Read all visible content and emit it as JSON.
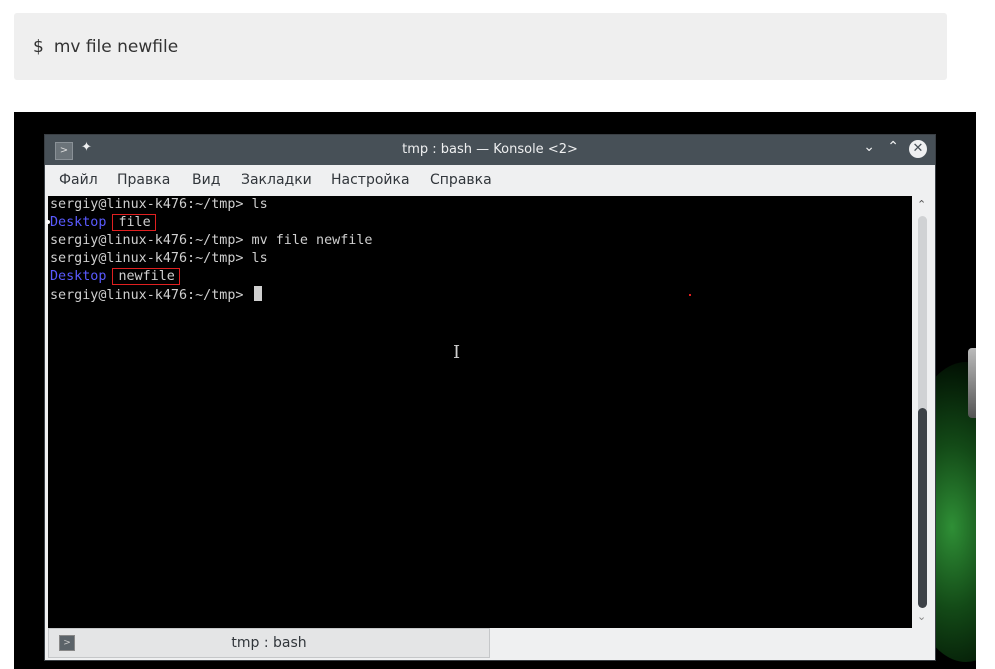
{
  "snippet": {
    "prompt": "$",
    "command": "mv file newfile"
  },
  "window": {
    "title": "tmp : bash — Konsole <2>",
    "minimize_glyph": "⌄",
    "maximize_glyph": "⌃",
    "close_glyph": "✕"
  },
  "menu": [
    "Файл",
    "Правка",
    "Вид",
    "Закладки",
    "Настройка",
    "Справка"
  ],
  "terminal": {
    "lines": [
      {
        "prompt": "sergiy@linux-k476:~/tmp>",
        "cmd": " ls"
      },
      {
        "dir": "Desktop",
        "file": "file"
      },
      {
        "prompt": "sergiy@linux-k476:~/tmp>",
        "cmd": " mv file newfile"
      },
      {
        "prompt": "sergiy@linux-k476:~/tmp>",
        "cmd": " ls"
      },
      {
        "dir": "Desktop",
        "file": "newfile"
      },
      {
        "prompt": "sergiy@linux-k476:~/tmp>",
        "cmd": " "
      }
    ],
    "dir_color": "#5a5aff",
    "highlight_color": "#e02020"
  },
  "tab": {
    "label": "tmp : bash"
  },
  "icons": {
    "app": "konsole-icon",
    "pin": "pin-icon",
    "text_cursor": "ibeam-cursor-icon"
  }
}
